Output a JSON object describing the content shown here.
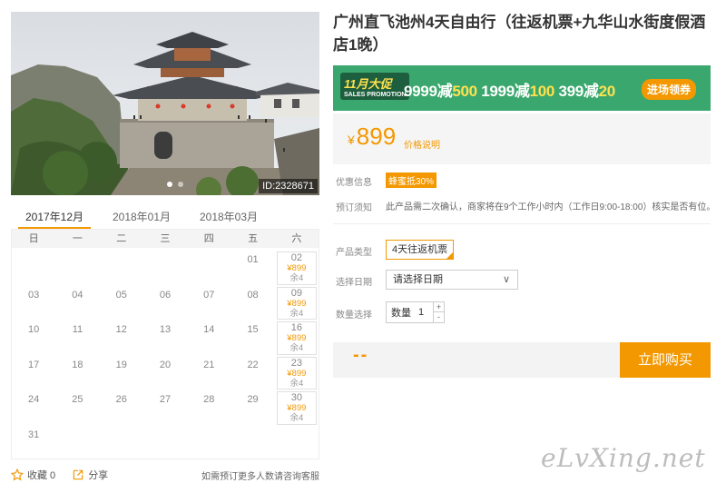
{
  "product": {
    "title": "广州直飞池州4天自由行（往返机票+九华山水街度假酒店1晚）",
    "photo_id": "ID:2328671"
  },
  "banner": {
    "tag": "11月大促",
    "tag_sub": "SALES PROMOTION",
    "d1_a": "9999减",
    "d1_b": "500",
    "d2_a": "1999减",
    "d2_b": "100",
    "d3_a": "399减",
    "d3_b": "20",
    "button": "进场领券"
  },
  "price": {
    "currency": "¥",
    "amount": "899",
    "note": "价格说明"
  },
  "info": {
    "promo_label": "优惠信息",
    "promo_badge": "蜂蜜抵30%",
    "notice_label": "预订须知",
    "notice_text": "此产品需二次确认，商家将在9个工作小时内（工作日9:00-18:00）核实是否有位。"
  },
  "form": {
    "type_label": "产品类型",
    "type_value": "4天往返机票",
    "date_label": "选择日期",
    "date_placeholder": "请选择日期",
    "qty_label": "数量选择",
    "qty_text": "数量",
    "qty_value": "1",
    "plus": "+",
    "minus": "-"
  },
  "buy": {
    "total": "--",
    "button": "立即购买"
  },
  "calendar": {
    "months": [
      "2017年12月",
      "2018年01月",
      "2018年03月"
    ],
    "weekdays": [
      "日",
      "一",
      "二",
      "三",
      "四",
      "五",
      "六"
    ],
    "rows": [
      [
        {
          "d": ""
        },
        {
          "d": ""
        },
        {
          "d": ""
        },
        {
          "d": ""
        },
        {
          "d": ""
        },
        {
          "d": "01"
        },
        {
          "d": "02",
          "p": "¥899",
          "s": "余4"
        }
      ],
      [
        {
          "d": "03"
        },
        {
          "d": "04"
        },
        {
          "d": "05"
        },
        {
          "d": "06"
        },
        {
          "d": "07"
        },
        {
          "d": "08"
        },
        {
          "d": "09",
          "p": "¥899",
          "s": "余4"
        }
      ],
      [
        {
          "d": "10"
        },
        {
          "d": "11"
        },
        {
          "d": "12"
        },
        {
          "d": "13"
        },
        {
          "d": "14"
        },
        {
          "d": "15"
        },
        {
          "d": "16",
          "p": "¥899",
          "s": "余4"
        }
      ],
      [
        {
          "d": "17"
        },
        {
          "d": "18"
        },
        {
          "d": "19"
        },
        {
          "d": "20"
        },
        {
          "d": "21"
        },
        {
          "d": "22"
        },
        {
          "d": "23",
          "p": "¥899",
          "s": "余4"
        }
      ],
      [
        {
          "d": "24"
        },
        {
          "d": "25"
        },
        {
          "d": "26"
        },
        {
          "d": "27"
        },
        {
          "d": "28"
        },
        {
          "d": "29"
        },
        {
          "d": "30",
          "p": "¥899",
          "s": "余4"
        }
      ],
      [
        {
          "d": "31"
        },
        {
          "d": ""
        },
        {
          "d": ""
        },
        {
          "d": ""
        },
        {
          "d": ""
        },
        {
          "d": ""
        },
        {
          "d": ""
        }
      ]
    ]
  },
  "footer": {
    "favorite": "收藏 0",
    "share": "分享",
    "note": "如需预订更多人数请咨询客服"
  },
  "watermark": "eLvXing.net",
  "colors": {
    "accent": "#f39800",
    "banner_bg": "#3aa86e"
  }
}
